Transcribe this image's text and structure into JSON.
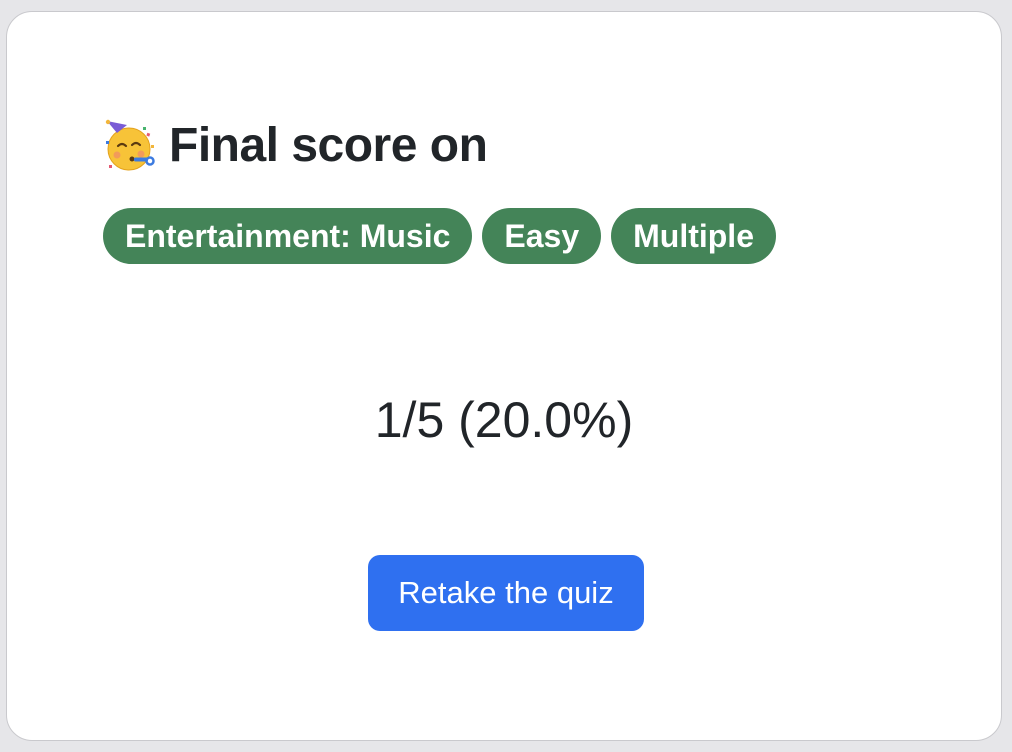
{
  "header": {
    "emoji_icon": "partying-face-icon",
    "title": "Final score on"
  },
  "badges": [
    {
      "label": "Entertainment: Music"
    },
    {
      "label": "Easy"
    },
    {
      "label": "Multiple"
    }
  ],
  "result": {
    "score_text": "1/5 (20.0%)",
    "correct": 1,
    "total": 5,
    "percent": 20.0
  },
  "actions": {
    "retake_label": "Retake the quiz"
  },
  "colors": {
    "badge_bg": "#448458",
    "button_bg": "#2f70f0",
    "text": "#212529"
  }
}
